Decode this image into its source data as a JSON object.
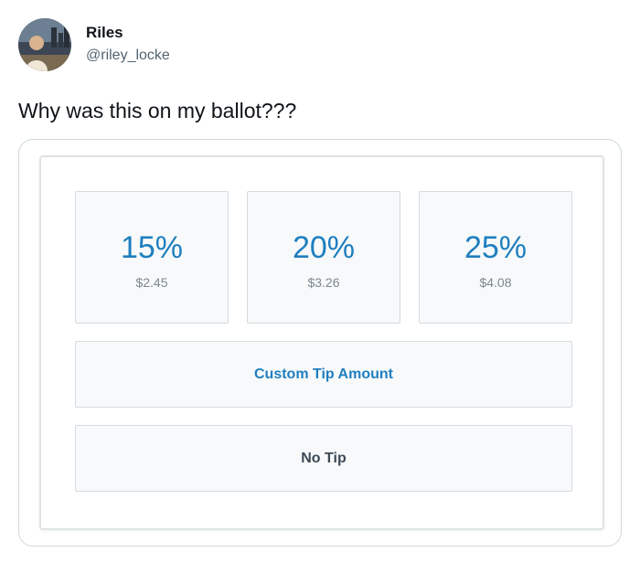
{
  "tweet": {
    "display_name": "Riles",
    "handle": "@riley_locke",
    "text": "Why was this on my ballot???"
  },
  "tip_screen": {
    "options": [
      {
        "percent": "15%",
        "amount": "$2.45"
      },
      {
        "percent": "20%",
        "amount": "$3.26"
      },
      {
        "percent": "25%",
        "amount": "$4.08"
      }
    ],
    "custom_label": "Custom Tip Amount",
    "no_tip_label": "No Tip"
  },
  "colors": {
    "accent": "#1f7fbf",
    "no_tip_text": "#3d4a56",
    "muted": "#7d8790"
  }
}
